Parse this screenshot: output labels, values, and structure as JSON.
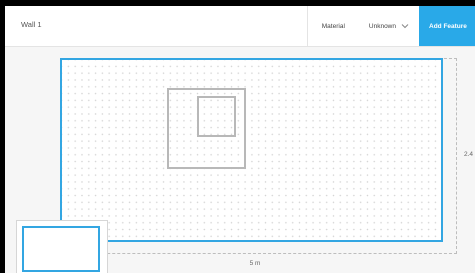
{
  "header": {
    "title": "Wall 1",
    "material_label": "Material",
    "material_value": "Unknown",
    "add_feature_label": "Add Feature"
  },
  "canvas": {
    "width_dimension": "5 m",
    "height_dimension": "2.4"
  },
  "colors": {
    "accent": "#29a9e8",
    "wall_border": "#33a6e2",
    "feature_border": "#b8b8b8"
  },
  "icons": {
    "material_dropdown": "chevron-down-icon"
  }
}
